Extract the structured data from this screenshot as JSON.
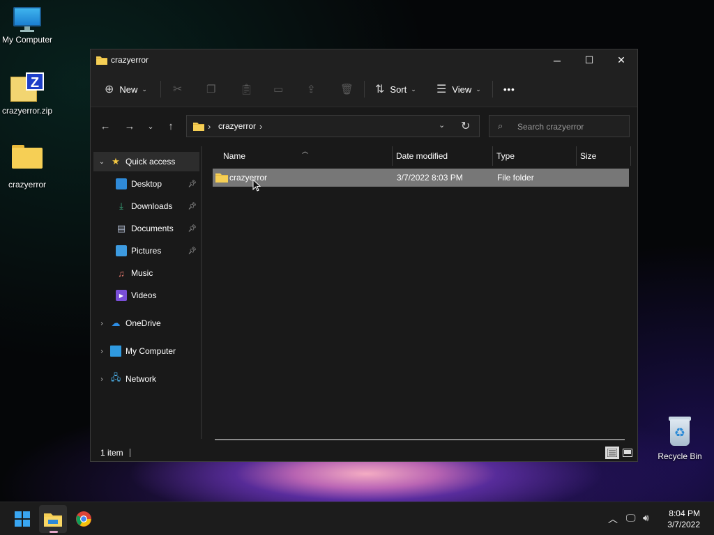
{
  "desktop": {
    "icons": [
      {
        "label": "My Computer"
      },
      {
        "label": "crazyerror.zip"
      },
      {
        "label": "crazyerror"
      },
      {
        "label": "Recycle Bin"
      }
    ]
  },
  "window": {
    "title": "crazyerror",
    "controls": {
      "minimize": "─",
      "maximize": "☐",
      "close": "✕"
    }
  },
  "cmdbar": {
    "new_label": "New",
    "sort_label": "Sort",
    "view_label": "View",
    "more_label": "•••"
  },
  "address": {
    "path": "crazyerror",
    "separator": "›"
  },
  "search": {
    "placeholder": "Search crazyerror"
  },
  "navpane": {
    "quick_access": "Quick access",
    "items": [
      {
        "label": "Desktop",
        "pinned": true
      },
      {
        "label": "Downloads",
        "pinned": true
      },
      {
        "label": "Documents",
        "pinned": true
      },
      {
        "label": "Pictures",
        "pinned": true
      },
      {
        "label": "Music",
        "pinned": false
      },
      {
        "label": "Videos",
        "pinned": false
      }
    ],
    "onedrive": "OneDrive",
    "my_computer": "My Computer",
    "network": "Network"
  },
  "columns": {
    "name": "Name",
    "date_modified": "Date modified",
    "type": "Type",
    "size": "Size"
  },
  "files": [
    {
      "name": "crazyerror",
      "date_modified": "3/7/2022 8:03 PM",
      "type": "File folder",
      "size": ""
    }
  ],
  "status": {
    "item_count": "1 item"
  },
  "taskbar": {
    "time": "8:04 PM",
    "date": "3/7/2022"
  },
  "colors": {
    "accent": "#39a6f2",
    "folder": "#f6cf55",
    "selected_row": "#777777"
  }
}
